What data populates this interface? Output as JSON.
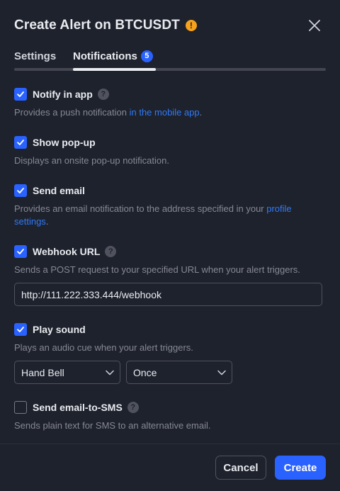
{
  "dialog": {
    "title": "Create Alert on BTCUSDT",
    "warning_icon": "!",
    "close_icon": "close-icon"
  },
  "tabs": [
    {
      "label": "Settings",
      "active": false
    },
    {
      "label": "Notifications",
      "active": true,
      "badge": "5"
    }
  ],
  "notifications": {
    "notify_in_app": {
      "label": "Notify in app",
      "checked": true,
      "help": "?",
      "desc_prefix": "Provides a push notification ",
      "desc_link": "in the mobile app",
      "desc_suffix": "."
    },
    "show_popup": {
      "label": "Show pop-up",
      "checked": true,
      "desc": "Displays an onsite pop-up notification."
    },
    "send_email": {
      "label": "Send email",
      "checked": true,
      "desc_prefix": "Provides an email notification to the address specified in your ",
      "desc_link": "profile settings",
      "desc_suffix": "."
    },
    "webhook": {
      "label": "Webhook URL",
      "checked": true,
      "help": "?",
      "desc": "Sends a POST request to your specified URL when your alert triggers.",
      "url_value": "http://111.222.333.444/webhook"
    },
    "play_sound": {
      "label": "Play sound",
      "checked": true,
      "desc": "Plays an audio cue when your alert triggers.",
      "sound_value": "Hand Bell",
      "frequency_value": "Once"
    },
    "email_to_sms": {
      "label": "Send email-to-SMS",
      "checked": false,
      "help": "?",
      "desc": "Sends plain text for SMS to an alternative email."
    }
  },
  "footer": {
    "cancel_label": "Cancel",
    "create_label": "Create"
  },
  "colors": {
    "background": "#1e222d",
    "accent": "#2962ff",
    "link": "#3179f5",
    "warning": "#f7a21b"
  }
}
